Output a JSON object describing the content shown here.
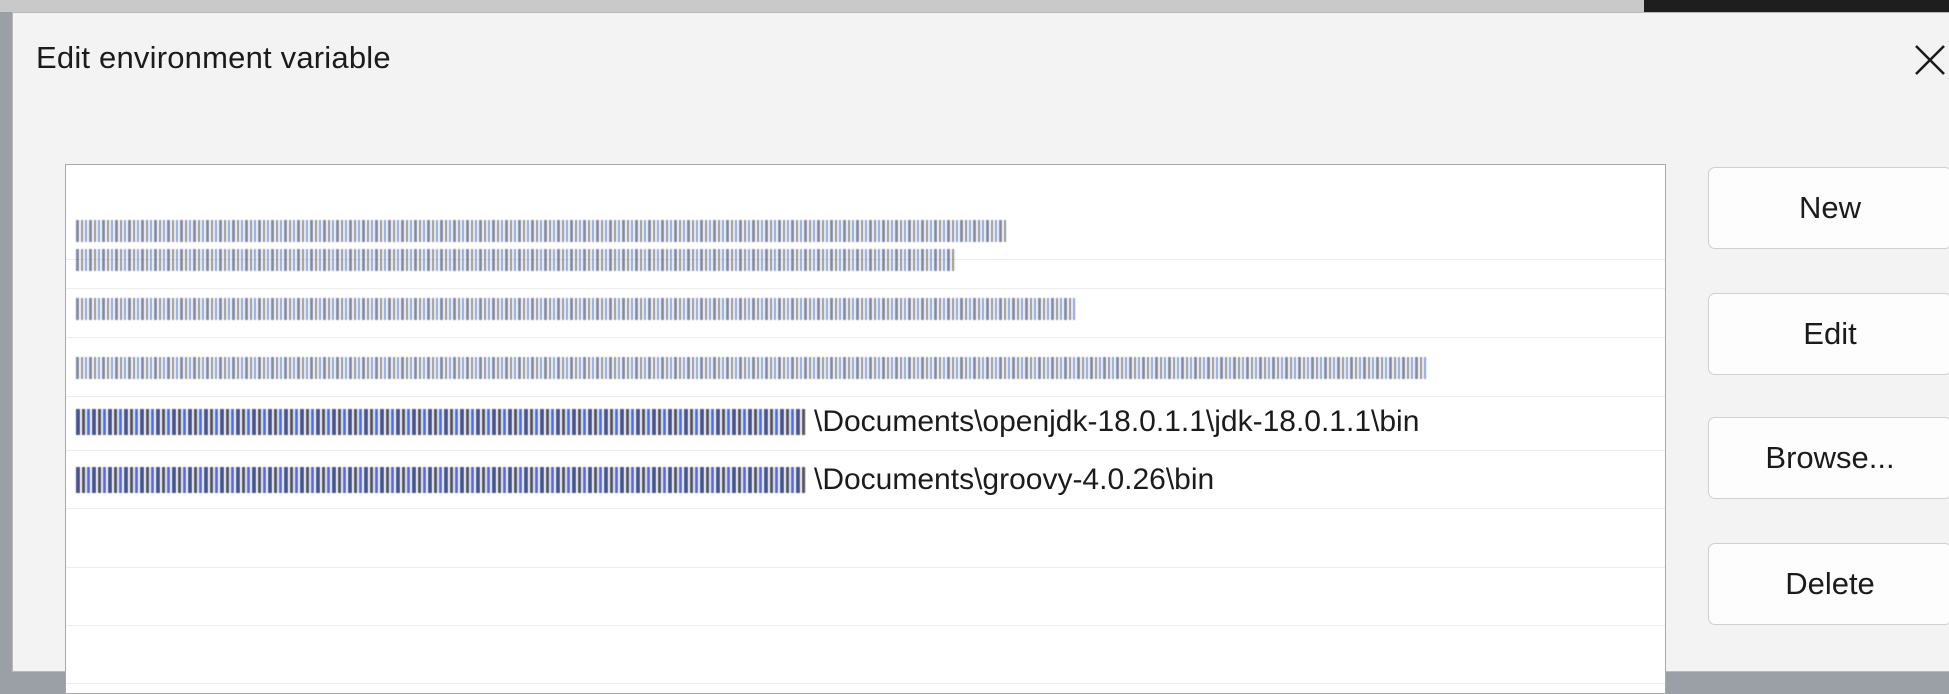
{
  "dialog": {
    "title": "Edit environment variable"
  },
  "list": {
    "entries": [
      {
        "visible_suffix": "",
        "masked_width": 930,
        "style": "thin"
      },
      {
        "visible_suffix": "",
        "masked_width": 880,
        "style": "thin"
      },
      {
        "visible_suffix": "",
        "masked_width": 1000,
        "style": "thin"
      },
      {
        "visible_suffix": "",
        "masked_width": 1350,
        "style": "thin"
      },
      {
        "visible_suffix": "\\Documents\\openjdk-18.0.1.1\\jdk-18.0.1.1\\bin",
        "masked_width": 730,
        "style": "bold"
      },
      {
        "visible_suffix": "\\Documents\\groovy-4.0.26\\bin",
        "masked_width": 730,
        "style": "bold"
      },
      {
        "visible_suffix": "",
        "masked_width": 0,
        "style": "empty"
      },
      {
        "visible_suffix": "",
        "masked_width": 0,
        "style": "empty"
      },
      {
        "visible_suffix": "",
        "masked_width": 0,
        "style": "empty"
      }
    ]
  },
  "buttons": {
    "new_label": "New",
    "edit_label": "Edit",
    "browse_label": "Browse...",
    "delete_label": "Delete"
  },
  "icons": {
    "close": "close-icon"
  }
}
